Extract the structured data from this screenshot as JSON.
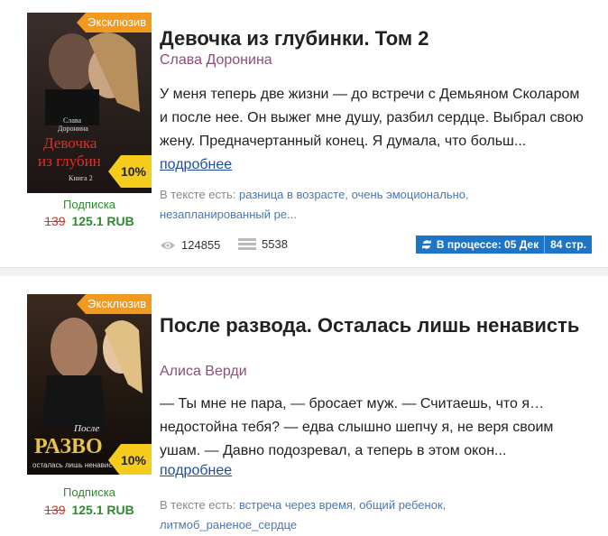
{
  "books": [
    {
      "exclusive": "Эксклюзив",
      "discount": "10%",
      "subscription": "Подписка",
      "price_old": "139",
      "price_new": "125.1 RUB",
      "title": "Девочка из глубинки. Том 2",
      "author": "Слава Доронина",
      "description": "У меня теперь две жизни — до встречи с Демьяном Сколаром и после нее. Он выжег мне душу, разбил сердце. Выбрал свою жену. Предначертанный конец. Я думала, что больш...",
      "more": "подробнее",
      "tags_label": "В тексте есть:",
      "tags": [
        "разница в возрасте",
        "очень эмоционально",
        "незапланированный ре..."
      ],
      "views": "124855",
      "library": "5538",
      "status": "В процессе: 05 Дек",
      "pages": "84 стр.",
      "cover_texts": [
        "Слава",
        "Доронина",
        "Девочка",
        "из глубин",
        "Книга 2"
      ]
    },
    {
      "exclusive": "Эксклюзив",
      "discount": "10%",
      "subscription": "Подписка",
      "price_old": "139",
      "price_new": "125.1 RUB",
      "title": "После развода. Осталась лишь ненависть",
      "author": "Алиса Верди",
      "description": "— Ты мне не пара, — бросает муж. — Считаешь, что я… недостойна тебя? — едва слышно шепчу я, не веря своим ушам. — Давно подозревал, а теперь в этом окон...",
      "more": "подробнее",
      "tags_label": "В тексте есть:",
      "tags": [
        "встреча через время",
        "общий ребенок",
        "литмоб_раненое_сердце"
      ],
      "cover_texts": [
        "После",
        "РАЗВО",
        "осталась лишь ненависть"
      ]
    }
  ],
  "colors": {
    "accent": "#f39a1e",
    "discount": "#f6cc1c",
    "link": "#1c4fa0",
    "author": "#8b4d7a",
    "price": "#2e8b2e",
    "status": "#1e74c6"
  }
}
